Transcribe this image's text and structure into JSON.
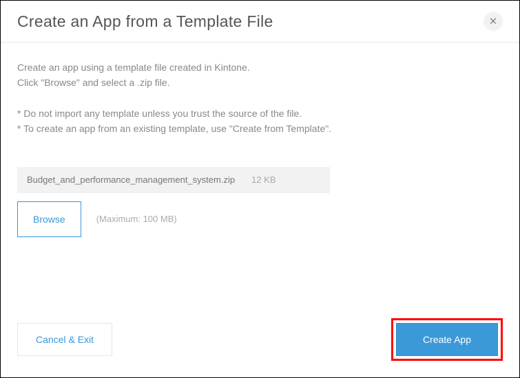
{
  "header": {
    "title": "Create an App from a Template File"
  },
  "content": {
    "intro_line1": "Create an app using a template file created in Kintone.",
    "intro_line2": "Click \"Browse\" and select a .zip file.",
    "note1": "* Do not import any template unless you trust the source of the file.",
    "note2": "* To create an app from an existing template, use \"Create from Template\".",
    "file": {
      "name": "Budget_and_performance_management_system.zip",
      "size": "12 KB"
    },
    "browse_label": "Browse",
    "max_label": "(Maximum: 100 MB)"
  },
  "footer": {
    "cancel_label": "Cancel & Exit",
    "create_label": "Create App"
  }
}
